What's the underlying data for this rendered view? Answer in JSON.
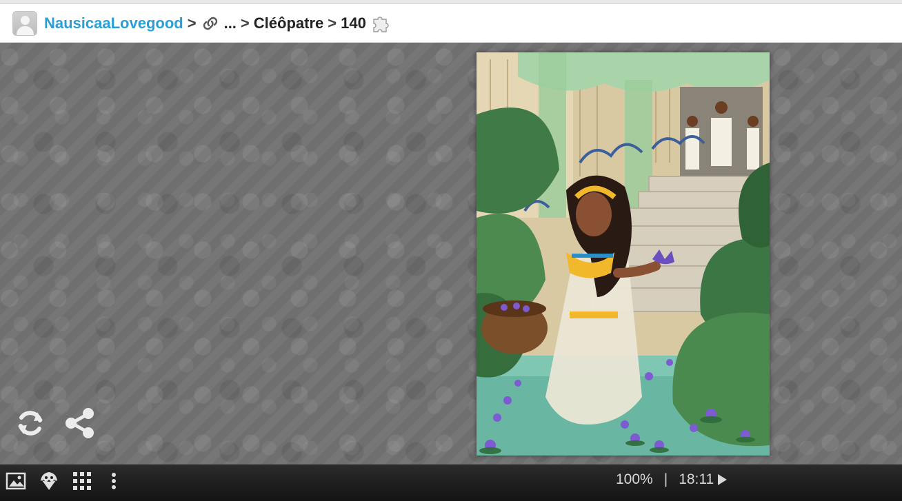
{
  "breadcrumb": {
    "user": "NausicaaLovegood",
    "separator": ">",
    "ellipsis": "...",
    "collection": "Cléôpatre",
    "piece_count": "140"
  },
  "icons": {
    "avatar": "user-avatar",
    "link": "link-icon",
    "puzzle": "puzzle-piece-icon",
    "refresh": "refresh-icon",
    "share": "share-icon",
    "image": "image-icon",
    "ghost": "ghost-icon",
    "grid": "grid-icon",
    "menu": "more-vertical-icon",
    "play": "play-icon"
  },
  "status": {
    "zoom": "100%",
    "divider": "|",
    "time": "18:11"
  },
  "colors": {
    "user_link": "#2a9fd6",
    "stage_bg": "#6f6f6f",
    "bar_bg": "#1e1e1e"
  }
}
